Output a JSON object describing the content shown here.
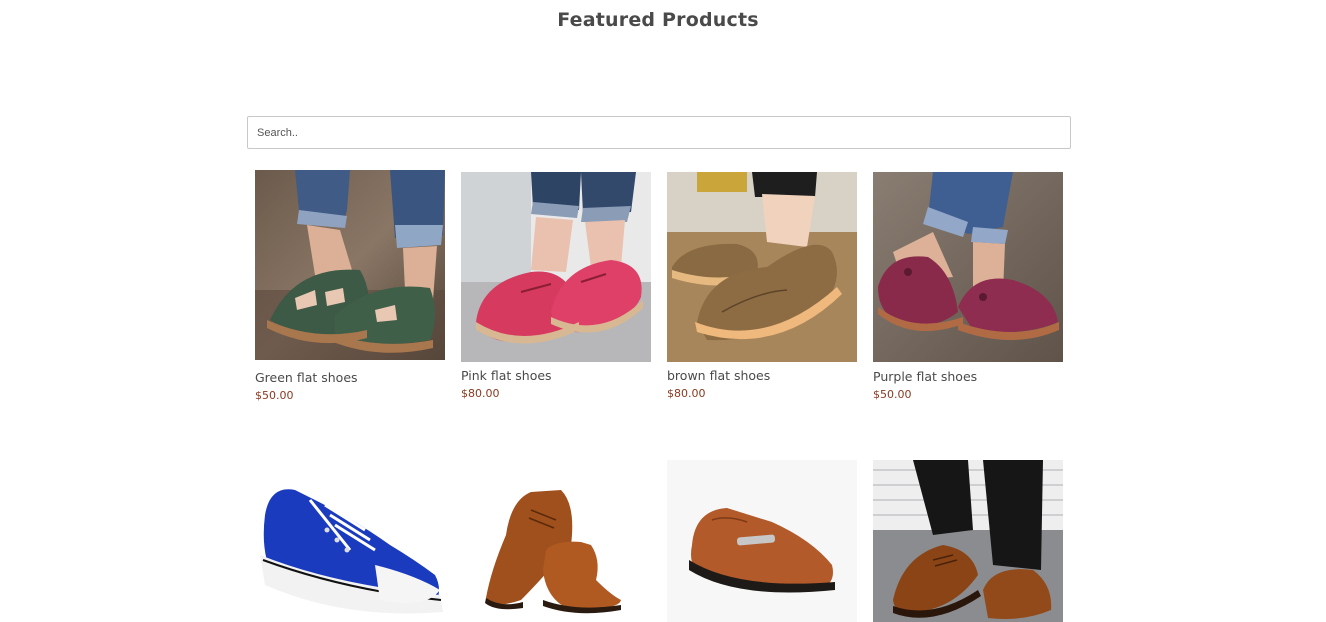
{
  "section": {
    "title": "Featured Products"
  },
  "search": {
    "placeholder": "Search.."
  },
  "products": [
    {
      "name": "Green flat shoes",
      "price": "$50.00",
      "image": "green-open-sandal-worn"
    },
    {
      "name": "Pink flat shoes",
      "price": "$80.00",
      "image": "pink-loafer-worn"
    },
    {
      "name": "brown flat shoes",
      "price": "$80.00",
      "image": "brown-loafer-worn"
    },
    {
      "name": "Purple flat shoes",
      "price": "$50.00",
      "image": "purple-sandal-worn"
    },
    {
      "name": "",
      "price": "",
      "image": "blue-canvas-sneaker"
    },
    {
      "name": "",
      "price": "",
      "image": "brown-formal-boots-pair"
    },
    {
      "name": "",
      "price": "",
      "image": "tan-leather-loafer"
    },
    {
      "name": "",
      "price": "",
      "image": "brown-oxford-worn"
    }
  ]
}
